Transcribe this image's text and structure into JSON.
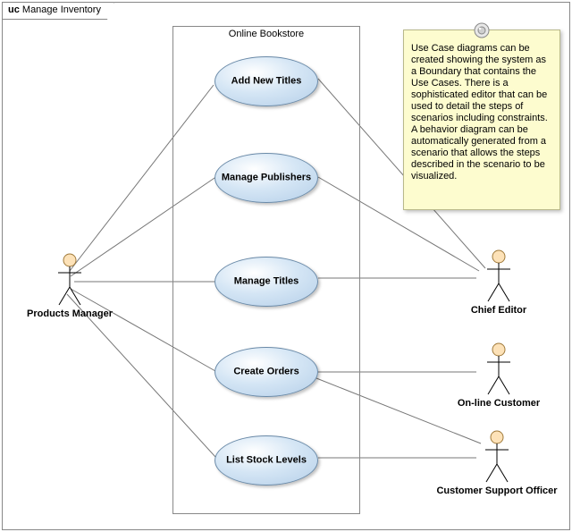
{
  "diagram": {
    "title_prefix": "uc",
    "title": "Manage Inventory",
    "boundary_name": "Online Bookstore",
    "note_text": "Use Case diagrams can be created showing the system as a Boundary that contains the Use Cases. There is a sophisticated editor that can be used to detail the steps of scenarios including constraints. A behavior diagram can be automatically generated from a scenario that allows the steps described in the scenario to be visualized.",
    "actors": {
      "products_manager": "Products Manager",
      "chief_editor": "Chief Editor",
      "online_customer": "On-line Customer",
      "customer_support_officer": "Customer Support Officer"
    },
    "usecases": {
      "add_new_titles": "Add New Titles",
      "manage_publishers": "Manage Publishers",
      "manage_titles": "Manage Titles",
      "create_orders": "Create Orders",
      "list_stock_levels": "List Stock Levels"
    },
    "associations": [
      [
        "products_manager",
        "add_new_titles"
      ],
      [
        "products_manager",
        "manage_publishers"
      ],
      [
        "products_manager",
        "manage_titles"
      ],
      [
        "products_manager",
        "create_orders"
      ],
      [
        "products_manager",
        "list_stock_levels"
      ],
      [
        "chief_editor",
        "add_new_titles"
      ],
      [
        "chief_editor",
        "manage_publishers"
      ],
      [
        "chief_editor",
        "manage_titles"
      ],
      [
        "online_customer",
        "create_orders"
      ],
      [
        "customer_support_officer",
        "create_orders"
      ],
      [
        "customer_support_officer",
        "list_stock_levels"
      ]
    ]
  }
}
